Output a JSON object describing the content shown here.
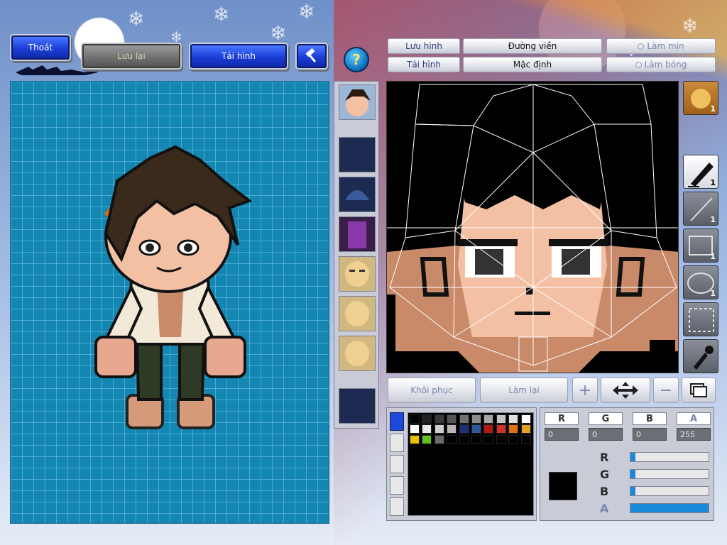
{
  "top_buttons": {
    "exit": "Thoát",
    "save": "Lưu lại",
    "reload": "Tải hình"
  },
  "editor_menu": {
    "save_image": "Lưu hình",
    "load_image": "Tải hình",
    "outline": "Đường viền",
    "default": "Mặc định",
    "smooth": "Làm mịn",
    "shadow": "Làm bóng"
  },
  "bottom_buttons": {
    "restore": "Khôi phục",
    "redo": "Làm lại"
  },
  "tools": {
    "face_count": "1",
    "pen_count": "1",
    "line_count": "1",
    "rect_count": "1",
    "ellipse_count": "1"
  },
  "rgba": {
    "r_label": "R",
    "g_label": "G",
    "b_label": "B",
    "a_label": "A",
    "r": "0",
    "g": "0",
    "b": "0",
    "a": "255",
    "current_color": "#000000"
  },
  "sliders": {
    "r_fraction": 0.0,
    "g_fraction": 0.0,
    "b_fraction": 0.0,
    "a_fraction": 1.0
  },
  "palette_colors": [
    "#000000",
    "#202020",
    "#3a3a3a",
    "#555555",
    "#707070",
    "#8c8c8c",
    "#a8a8a8",
    "#c4c4c4",
    "#e0e0e0",
    "#ffffff",
    "#ffffff",
    "#e8e8e8",
    "#d0d0d0",
    "#b8b8b8",
    "#1e2f78",
    "#2a5a9a",
    "#b01818",
    "#d03030",
    "#e07010",
    "#e0a020",
    "#e8c000",
    "#60c020",
    "#6a6a6a",
    "#000000",
    "#000000",
    "#000000",
    "#000000",
    "#000000",
    "#000000",
    "#000000"
  ],
  "icons": {
    "help": "question-mark-icon",
    "hammer": "hammer-icon"
  }
}
